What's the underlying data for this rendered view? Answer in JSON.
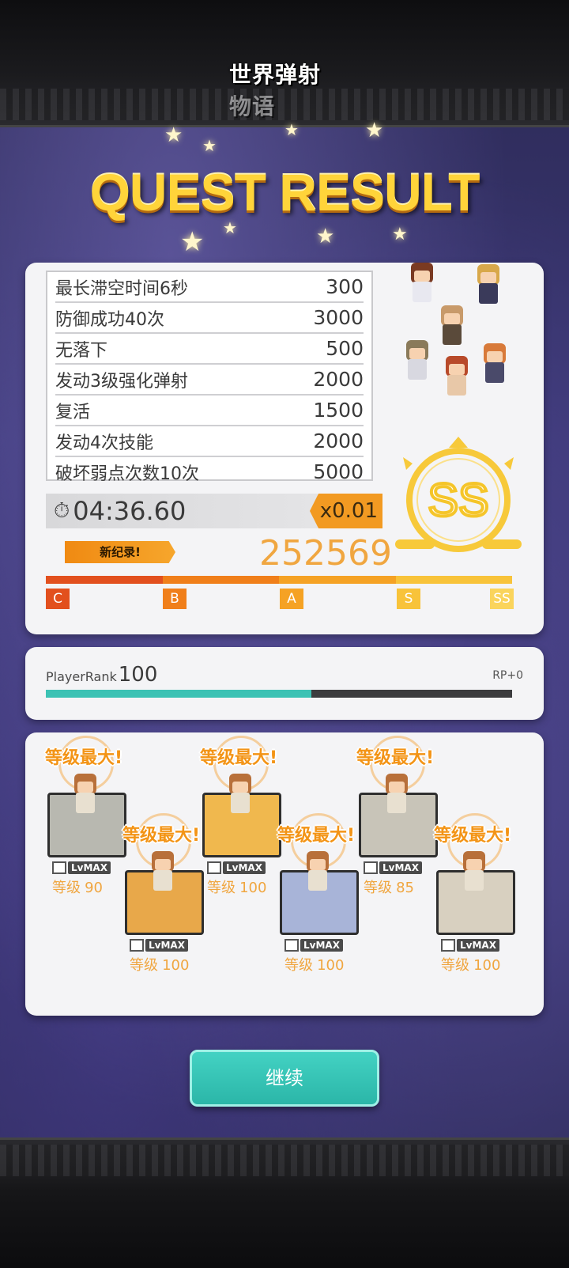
{
  "header": {
    "logo_text": "世界弹射物语"
  },
  "title": "QUEST RESULT",
  "results": {
    "missions": [
      {
        "label": "最长滞空时间6秒",
        "value": "300"
      },
      {
        "label": "防御成功40次",
        "value": "3000"
      },
      {
        "label": "无落下",
        "value": "500"
      },
      {
        "label": "发动3级强化弹射",
        "value": "2000"
      },
      {
        "label": "复活",
        "value": "1500"
      },
      {
        "label": "发动4次技能",
        "value": "2000"
      },
      {
        "label": "破坏弱点次数10次",
        "value": "5000"
      }
    ],
    "time": "04:36.60",
    "multiplier": "x0.01",
    "new_record": "新纪录!",
    "total_score": "252569",
    "rank_grade": "SS",
    "rank_scale": [
      "C",
      "B",
      "A",
      "S",
      "SS"
    ],
    "rank_colors": [
      "#e2501e",
      "#f07f1a",
      "#f5a224",
      "#f8c33a",
      "#fad45c"
    ]
  },
  "player_rank": {
    "label": "PlayerRank",
    "value": "100",
    "rp": "RP+0",
    "progress": 0.57
  },
  "characters": [
    {
      "maxed_label": "等级最大!",
      "lv_tag": "LvMAX",
      "level_prefix": "等级",
      "level": "90",
      "pedestal": "#b8b8b0"
    },
    {
      "maxed_label": "等级最大!",
      "lv_tag": "LvMAX",
      "level_prefix": "等级",
      "level": "100",
      "pedestal": "#e8a84a"
    },
    {
      "maxed_label": "等级最大!",
      "lv_tag": "LvMAX",
      "level_prefix": "等级",
      "level": "100",
      "pedestal": "#f0b84e"
    },
    {
      "maxed_label": "等级最大!",
      "lv_tag": "LvMAX",
      "level_prefix": "等级",
      "level": "100",
      "pedestal": "#a8b4d8"
    },
    {
      "maxed_label": "等级最大!",
      "lv_tag": "LvMAX",
      "level_prefix": "等级",
      "level": "85",
      "pedestal": "#c8c4b8"
    },
    {
      "maxed_label": "等级最大!",
      "lv_tag": "LvMAX",
      "level_prefix": "等级",
      "level": "100",
      "pedestal": "#d8d0c0"
    }
  ],
  "continue_button": "继续",
  "colors": {
    "accent_orange": "#f29a22",
    "teal": "#3cc2b4",
    "gold": "#f5c52a"
  }
}
